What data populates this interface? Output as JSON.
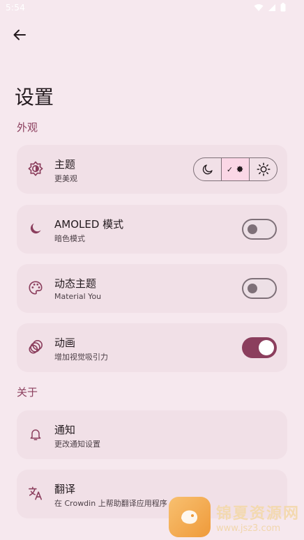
{
  "status": {
    "time": "5:54"
  },
  "header": {
    "title": "设置"
  },
  "sections": {
    "appearance": "外观",
    "about": "关于"
  },
  "cards": {
    "theme": {
      "title": "主题",
      "subtitle": "更美观",
      "icon": "contrast-icon",
      "theme_options": [
        "dark",
        "auto",
        "light"
      ],
      "selected": "auto"
    },
    "amoled": {
      "title": "AMOLED 模式",
      "subtitle": "暗色模式",
      "icon": "moon-icon",
      "enabled": false
    },
    "dynamic": {
      "title": "动态主题",
      "subtitle": "Material You",
      "icon": "palette-icon",
      "enabled": false
    },
    "animation": {
      "title": "动画",
      "subtitle": "增加视觉吸引力",
      "icon": "animation-icon",
      "enabled": true
    },
    "notifications": {
      "title": "通知",
      "subtitle": "更改通知设置",
      "icon": "bell-icon"
    },
    "translate": {
      "title": "翻译",
      "subtitle": "在 Crowdin 上帮助翻译应用程序",
      "icon": "translate-icon"
    }
  },
  "watermark": {
    "line1": "锦夏资源网",
    "line2": "www.jsz3.com"
  },
  "colors": {
    "accent": "#8b3e5d",
    "background": "#f6e8ee",
    "card": "#f1e0e7"
  }
}
